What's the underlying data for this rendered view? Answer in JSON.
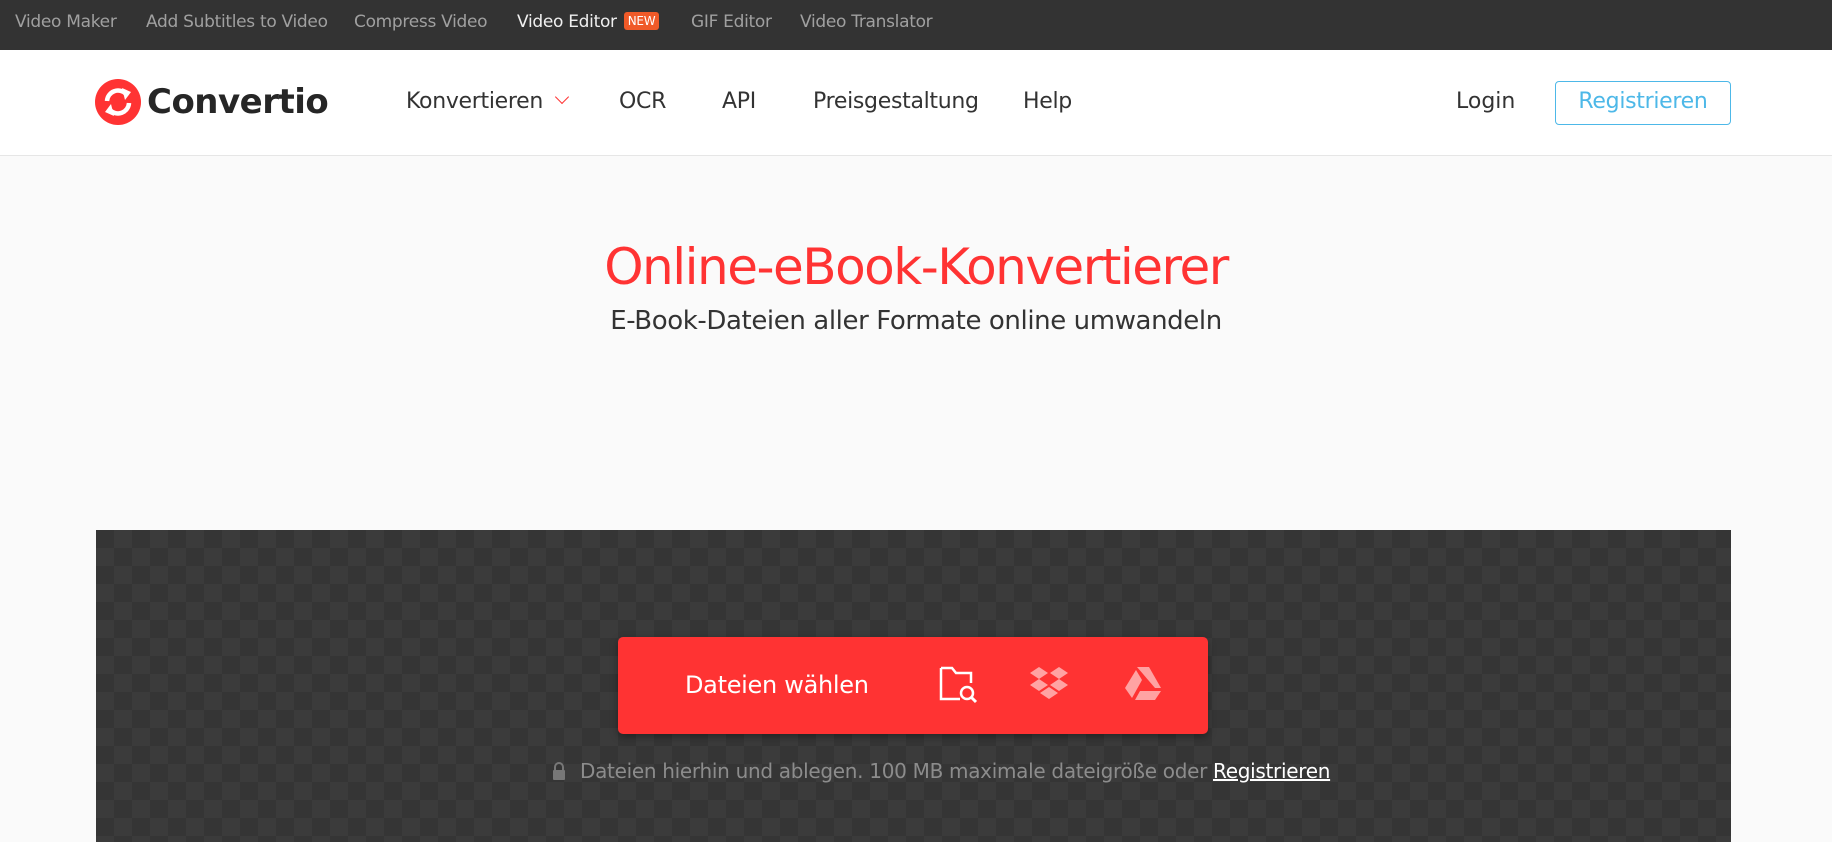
{
  "topbar": {
    "links": [
      {
        "label": "Video Maker"
      },
      {
        "label": "Add Subtitles to Video"
      },
      {
        "label": "Compress Video"
      },
      {
        "label": "Video Editor",
        "badge": "NEW",
        "active": true
      },
      {
        "label": "GIF Editor"
      },
      {
        "label": "Video Translator"
      }
    ]
  },
  "header": {
    "logo_text": "Convertio",
    "nav": [
      {
        "label": "Konvertieren",
        "has_dropdown": true
      },
      {
        "label": "OCR"
      },
      {
        "label": "API"
      },
      {
        "label": "Preisgestaltung"
      },
      {
        "label": "Help"
      }
    ],
    "login_label": "Login",
    "register_label": "Registrieren"
  },
  "hero": {
    "title": "Online-eBook-Konvertierer",
    "subtitle": "E-Book-Dateien aller Formate online umwandeln"
  },
  "upload": {
    "choose_label": "Dateien wählen",
    "sources": [
      {
        "icon": "folder-search-icon",
        "name": "Computer"
      },
      {
        "icon": "dropbox-icon",
        "name": "Dropbox"
      },
      {
        "icon": "google-drive-icon",
        "name": "Google Drive"
      }
    ],
    "hint_text": "Dateien hierhin und ablegen. 100 MB maximale dateigröße oder",
    "hint_link": "Registrieren"
  },
  "colors": {
    "brand_red": "#ff3333",
    "accent_blue": "#4db8e8",
    "badge_orange": "#f05a28",
    "topbar_bg": "#333333"
  }
}
